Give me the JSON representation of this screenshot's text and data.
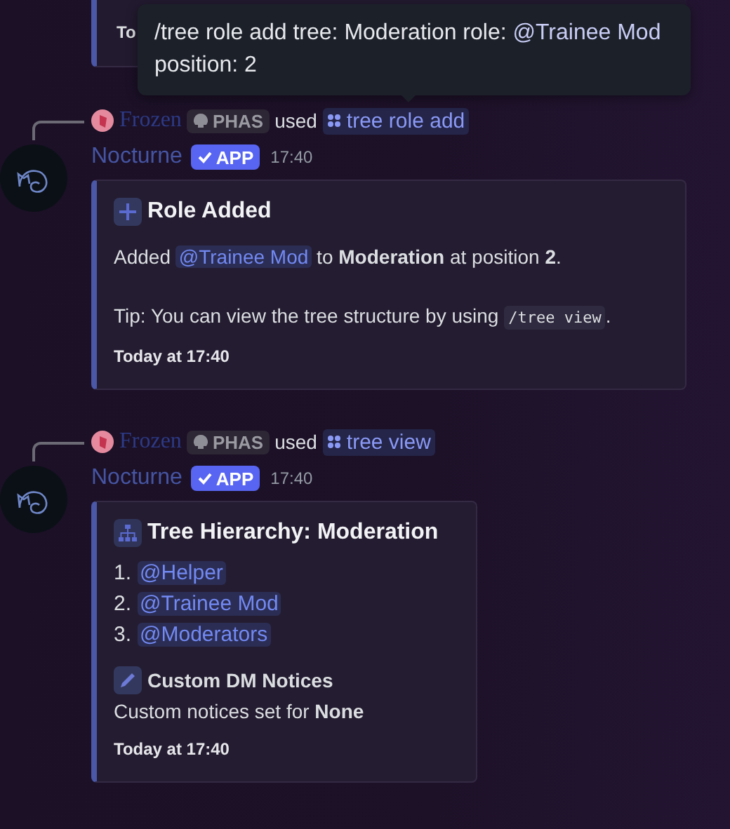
{
  "top_embed": {
    "footer": "To"
  },
  "tooltip": {
    "command": "/tree role add",
    "options": [
      {
        "name": "tree:",
        "value": "Moderation",
        "kind": "plain"
      },
      {
        "name": "role:",
        "value": "@Trainee Mod",
        "kind": "mention"
      },
      {
        "name": "position:",
        "value": "2",
        "kind": "plain"
      }
    ]
  },
  "messages": [
    {
      "reply": {
        "user": "Frozen",
        "tag": "PHAS",
        "used": "used",
        "command": "tree role add"
      },
      "author": "Nocturne",
      "badge": "APP",
      "time": "17:40",
      "embed": {
        "title": "Role Added",
        "sections": [
          {
            "kind": "paragraph",
            "segments": [
              {
                "kind": "text",
                "text": "Added "
              },
              {
                "kind": "mention",
                "text": "@Trainee Mod"
              },
              {
                "kind": "text",
                "text": " to **Moderation** at position **2**."
              }
            ]
          },
          {
            "kind": "paragraph",
            "segments": [
              {
                "kind": "text",
                "text": "Tip: You can view the tree structure by using "
              },
              {
                "kind": "code",
                "text": "/tree view"
              },
              {
                "kind": "text",
                "text": "."
              }
            ]
          }
        ],
        "footer": "Today at 17:40"
      }
    },
    {
      "reply": {
        "user": "Frozen",
        "tag": "PHAS",
        "used": "used",
        "command": "tree view"
      },
      "author": "Nocturne",
      "badge": "APP",
      "time": "17:40",
      "embed": {
        "title": "Tree Hierarchy: Moderation",
        "sections": [
          {
            "kind": "list",
            "items": [
              {
                "number": "1.",
                "mention": "@Helper"
              },
              {
                "number": "2.",
                "mention": "@Trainee Mod"
              },
              {
                "number": "3.",
                "mention": "@Moderators"
              }
            ]
          },
          {
            "kind": "field",
            "name": "Custom DM Notices",
            "value": "Custom notices set for **None**"
          }
        ],
        "footer": "Today at 17:40"
      }
    }
  ]
}
